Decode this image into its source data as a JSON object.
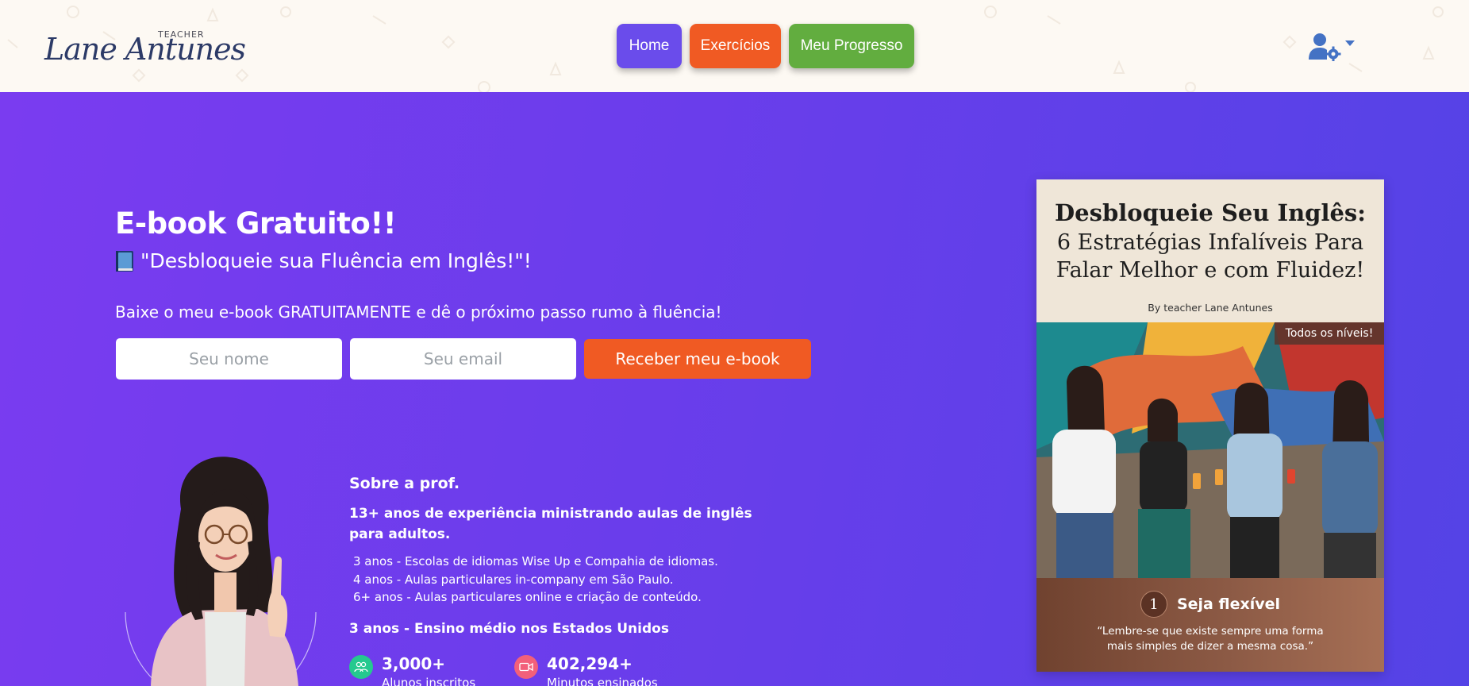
{
  "header": {
    "logo_teacher": "TEACHER",
    "logo_name": "Lane Antunes",
    "nav": [
      {
        "label": "Home",
        "color": "#6a4ceb"
      },
      {
        "label": "Exercícios",
        "color": "#f05a23"
      },
      {
        "label": "Meu Progresso",
        "color": "#62ad3f"
      }
    ],
    "user_icon": "user-gear-icon",
    "caret_icon": "caret-down-icon"
  },
  "hero": {
    "title": "E-book Gratuito!!",
    "subtitle_icon": "book-icon",
    "subtitle": "\"Desbloqueie sua Fluência em Inglês!\"!",
    "lead": "Baixe o meu e-book GRATUITAMENTE e dê o próximo passo rumo à fluência!",
    "form": {
      "name_placeholder": "Seu nome",
      "email_placeholder": "Seu email",
      "submit_label": "Receber meu e-book"
    }
  },
  "about": {
    "title": "Sobre a prof.",
    "experience": "13+ anos de experiência ministrando aulas de inglês para adultos.",
    "items": [
      "3 anos - Escolas de idiomas Wise Up e Compahia de idiomas.",
      "4 anos - Aulas particulares in-company em São Paulo.",
      "6+ anos - Aulas particulares online e criação de conteúdo."
    ],
    "us": "3 anos - Ensino médio nos Estados Unidos",
    "stats": [
      {
        "value": "3,000+",
        "label": "Alunos inscritos",
        "icon": "users-icon",
        "color": "#25c98f"
      },
      {
        "value": "402,294+",
        "label": "Minutos ensinados",
        "icon": "video-icon",
        "color": "#f2607a"
      }
    ]
  },
  "cover": {
    "title": "Desbloqueie Seu Inglês:",
    "subtitle_lines": [
      "6 Estratégias Infalíveis Para",
      "Falar Melhor e com Fluidez!"
    ],
    "by": "By teacher Lane Antunes",
    "badge": "Todos os níveis!",
    "tip_number": "1",
    "tip_title": "Seja flexível",
    "tip_quote": "“Lembre-se que existe sempre uma forma mais simples de dizer a mesma cosa.”"
  },
  "colors": {
    "header_bg": "#fdf9f3",
    "hero_start": "#7a3cf0",
    "hero_end": "#5443e6",
    "accent_orange": "#f05a23",
    "accent_green": "#62ad3f",
    "accent_purple": "#6a4ceb",
    "logo_navy": "#2c3a67"
  }
}
